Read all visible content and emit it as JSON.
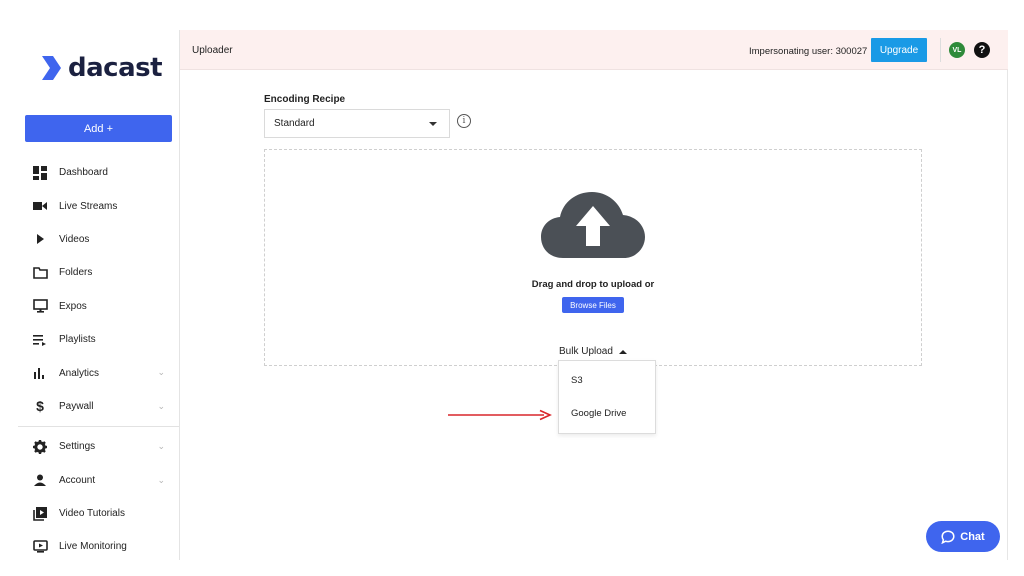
{
  "brand": {
    "name": "dacast",
    "logo_color": "#3f65ee"
  },
  "sidebar": {
    "add_label": "Add +",
    "items": [
      {
        "label": "Dashboard",
        "icon": "dashboard-icon",
        "expandable": false
      },
      {
        "label": "Live Streams",
        "icon": "video-camera-icon",
        "expandable": false
      },
      {
        "label": "Videos",
        "icon": "play-icon",
        "expandable": false
      },
      {
        "label": "Folders",
        "icon": "folder-icon",
        "expandable": false
      },
      {
        "label": "Expos",
        "icon": "monitor-icon",
        "expandable": false
      },
      {
        "label": "Playlists",
        "icon": "playlist-icon",
        "expandable": false
      },
      {
        "label": "Analytics",
        "icon": "bar-chart-icon",
        "expandable": true
      },
      {
        "label": "Paywall",
        "icon": "dollar-icon",
        "expandable": true
      },
      {
        "label": "Settings",
        "icon": "gear-icon",
        "expandable": true
      },
      {
        "label": "Account",
        "icon": "user-icon",
        "expandable": true
      },
      {
        "label": "Video Tutorials",
        "icon": "video-library-icon",
        "expandable": false
      },
      {
        "label": "Live Monitoring",
        "icon": "live-monitor-icon",
        "expandable": false
      }
    ]
  },
  "topbar": {
    "title": "Uploader",
    "impersonating": "Impersonating user: 300027",
    "upgrade_label": "Upgrade",
    "avatar_initials": "VL",
    "help_label": "?"
  },
  "encoding": {
    "label": "Encoding Recipe",
    "selected": "Standard",
    "info_label": "i"
  },
  "dropzone": {
    "text": "Drag and drop to upload or",
    "browse_label": "Browse Files",
    "bulk_label": "Bulk Upload"
  },
  "bulk_menu": {
    "items": [
      "S3",
      "Google Drive"
    ]
  },
  "chat": {
    "label": "Chat"
  },
  "colors": {
    "primary": "#3f65ee",
    "upgrade": "#1a9ae6",
    "topbar_bg": "#fdf0ef",
    "annotation_arrow": "#d9262b"
  }
}
